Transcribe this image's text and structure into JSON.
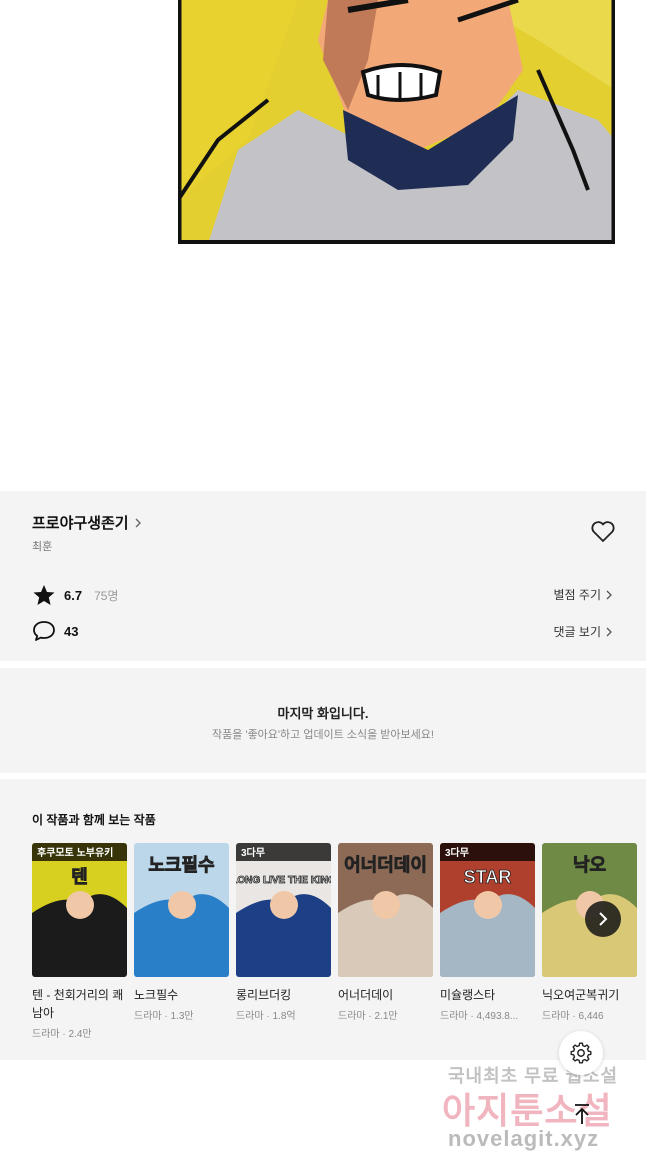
{
  "series": {
    "title": "프로야구생존기",
    "author": "최훈"
  },
  "stats": {
    "rating": "6.7",
    "rating_count": "75명",
    "comments": "43",
    "rate_label": "별점 주기",
    "comments_label": "댓글 보기"
  },
  "end_notice": {
    "title": "마지막 화입니다.",
    "subtitle": "작품을 '좋아요'하고 업데이트 소식을 받아보세요!"
  },
  "recommendations": {
    "heading": "이 작품과 함께 보는 작품",
    "items": [
      {
        "title": "텐 - 천회거리의 쾌남아",
        "meta": "드라마 · 2.4만",
        "thumb_text": "텐",
        "badge": "후쿠모토 노부유키",
        "colors": [
          "#1b1b1b",
          "#d8d020"
        ]
      },
      {
        "title": "노크필수",
        "meta": "드라마 · 1.3만",
        "thumb_text": "노크필수",
        "badge": "",
        "colors": [
          "#2a7fc9",
          "#bcd6ea"
        ]
      },
      {
        "title": "롱리브더킹",
        "meta": "드라마 · 1.8억",
        "thumb_text": "LONG LIVE THE KING",
        "badge": "3다무",
        "colors": [
          "#1d3f86",
          "#e9e6e3"
        ]
      },
      {
        "title": "어너더데이",
        "meta": "드라마 · 2.1만",
        "thumb_text": "어너더데이",
        "badge": "",
        "colors": [
          "#d8c9b8",
          "#8c6a55"
        ]
      },
      {
        "title": "미슐랭스타",
        "meta": "드라마 · 4,493.8...",
        "thumb_text": "STAR",
        "badge": "3다무",
        "colors": [
          "#a5b7c5",
          "#b0402e"
        ]
      },
      {
        "title": "닉오여군복귀기",
        "meta": "드라마 · 6,446",
        "thumb_text": "낙오",
        "badge": "",
        "colors": [
          "#d9c977",
          "#6e8a45"
        ]
      }
    ]
  },
  "watermark": {
    "line1": "국내최초 무료 웹소설",
    "line2": "아지툰소설",
    "line3": "novelagit.xyz"
  },
  "icons": {
    "heart": "heart-icon",
    "star": "star-icon",
    "comment": "comment-icon",
    "chevron": "chevron-right-icon",
    "gear": "gear-icon",
    "top": "arrow-up-icon"
  }
}
